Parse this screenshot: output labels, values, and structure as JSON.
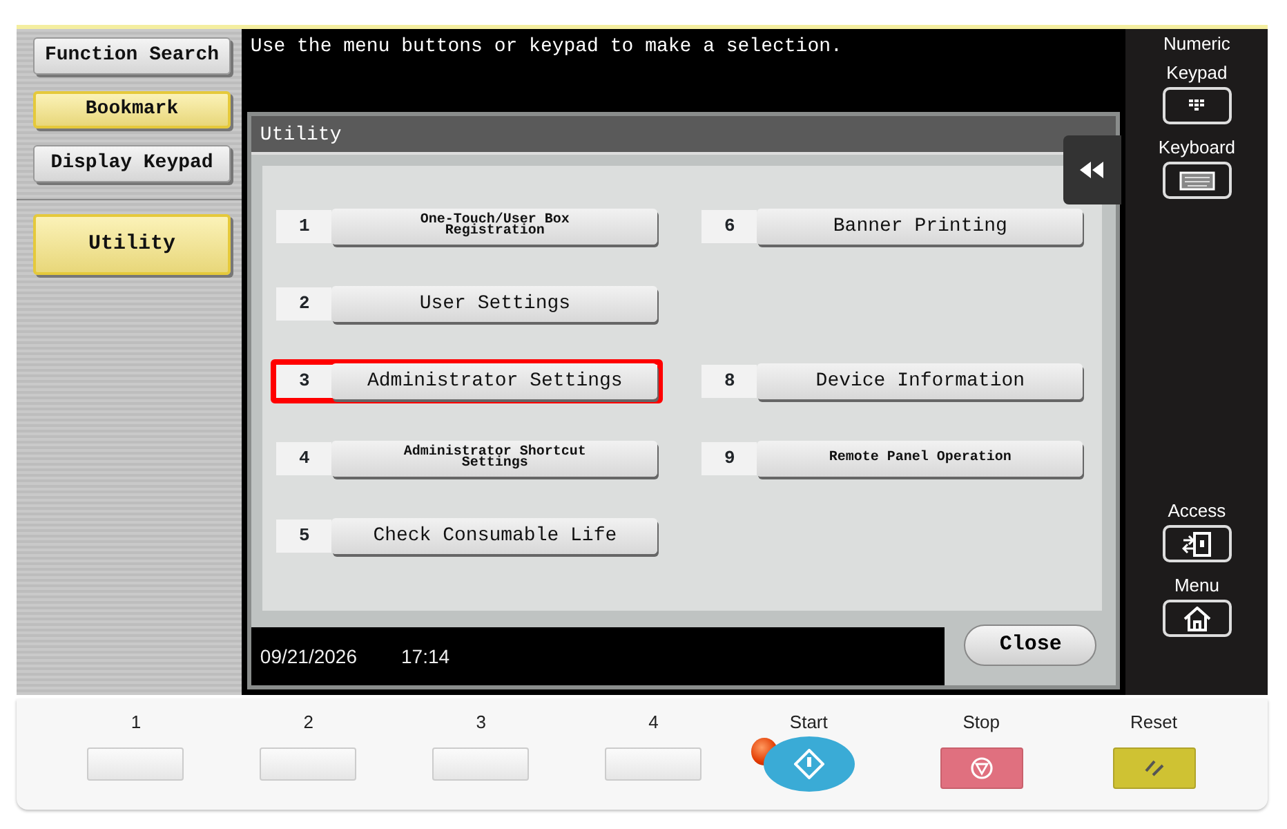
{
  "sidebar": {
    "items": [
      {
        "label": "Function Search",
        "active": false,
        "kind": "small"
      },
      {
        "label": "Bookmark",
        "active": true,
        "kind": "small"
      },
      {
        "label": "Display Keypad",
        "active": false,
        "kind": "small"
      },
      {
        "label": "Utility",
        "active": true,
        "kind": "large"
      }
    ]
  },
  "message": "Use the menu buttons or keypad to make a selection.",
  "dialog": {
    "title": "Utility",
    "columns": [
      {
        "items": [
          {
            "kind": "compact",
            "number": "1",
            "label": "One-Touch/User Box Registration",
            "selected": false
          },
          {
            "kind": "button",
            "number": "2",
            "label": "User Settings",
            "selected": false
          },
          {
            "kind": "button",
            "number": "3",
            "label": "Administrator Settings",
            "selected": true
          },
          {
            "kind": "compact",
            "number": "4",
            "label": "Administrator Shortcut Settings",
            "selected": false
          },
          {
            "kind": "button",
            "number": "5",
            "label": "Check Consumable Life",
            "selected": false
          }
        ]
      },
      {
        "items": [
          {
            "kind": "button",
            "number": "6",
            "label": "Banner Printing",
            "selected": false
          },
          {
            "kind": "blank"
          },
          {
            "kind": "button",
            "number": "8",
            "label": "Device Information",
            "selected": false
          },
          {
            "kind": "compact",
            "number": "9",
            "label": "Remote Panel Operation",
            "selected": false
          },
          {
            "kind": "blank"
          }
        ]
      }
    ],
    "date": "09/21/2026",
    "time": "17:14",
    "close": "Close"
  },
  "side_keys_top": [
    {
      "label": "Numeric Keypad",
      "kind": "keypad"
    },
    {
      "label": "Keyboard",
      "kind": "keyboard"
    }
  ],
  "side_keys_bottom": [
    {
      "label": "Access",
      "kind": "access"
    },
    {
      "label": "Menu",
      "kind": "home"
    }
  ],
  "hard_keys": [
    {
      "label": "1",
      "kind": "plain"
    },
    {
      "label": "2",
      "kind": "plain"
    },
    {
      "label": "3",
      "kind": "plain"
    },
    {
      "label": "4",
      "kind": "plain"
    },
    {
      "label": "Start",
      "kind": "start"
    },
    {
      "label": "Stop",
      "kind": "stop"
    },
    {
      "label": "Reset",
      "kind": "reset"
    }
  ]
}
